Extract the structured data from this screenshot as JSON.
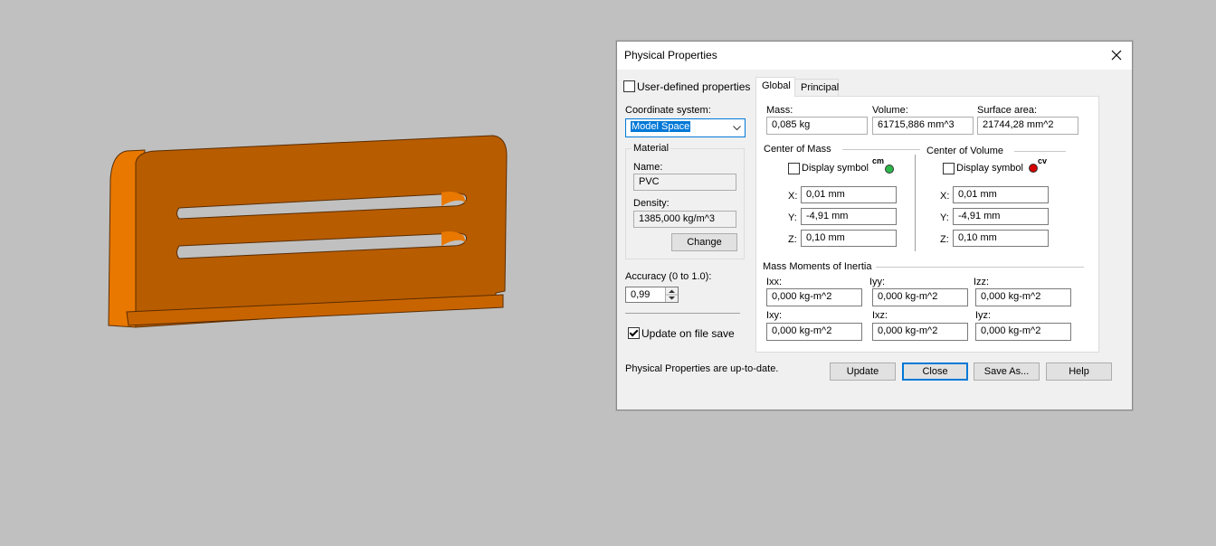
{
  "colors": {
    "part_main": "#b85c00",
    "part_side": "#e97800",
    "part_edge": "#5a2d00",
    "cm_dot": "#2db84a",
    "cv_dot": "#d40000",
    "accent": "#0078d7"
  },
  "dialog": {
    "title": "Physical Properties",
    "close_icon": "close-icon",
    "user_defined": {
      "label": "User-defined properties",
      "checked": false
    },
    "coord_label": "Coordinate system:",
    "coord_value": "Model Space",
    "material": {
      "group_label": "Material",
      "name_label": "Name:",
      "name_value": "PVC",
      "density_label": "Density:",
      "density_value": "1385,000 kg/m^3",
      "change_button": "Change"
    },
    "accuracy": {
      "label": "Accuracy (0 to 1.0):",
      "value": "0,99"
    },
    "update_on_save": {
      "label": "Update on file save",
      "checked": true
    },
    "status": "Physical Properties are up-to-date.",
    "tabs": [
      {
        "label": "Global",
        "active": true
      },
      {
        "label": "Principal",
        "active": false
      }
    ],
    "global": {
      "mass_label": "Mass:",
      "mass_value": "0,085 kg",
      "volume_label": "Volume:",
      "volume_value": "61715,886 mm^3",
      "surface_label": "Surface area:",
      "surface_value": "21744,28 mm^2",
      "com": {
        "title": "Center of Mass",
        "display_label": "Display symbol",
        "symbol": "cm",
        "x_label": "X:",
        "x": "0,01 mm",
        "y_label": "Y:",
        "y": "-4,91 mm",
        "z_label": "Z:",
        "z": "0,10 mm"
      },
      "cov": {
        "title": "Center of Volume",
        "display_label": "Display symbol",
        "symbol": "cv",
        "x_label": "X:",
        "x": "0,01 mm",
        "y_label": "Y:",
        "y": "-4,91 mm",
        "z_label": "Z:",
        "z": "0,10 mm"
      },
      "inertia": {
        "title": "Mass Moments of Inertia",
        "ixx_label": "Ixx:",
        "ixx": "0,000 kg-m^2",
        "iyy_label": "Iyy:",
        "iyy": "0,000 kg-m^2",
        "izz_label": "Izz:",
        "izz": "0,000 kg-m^2",
        "ixy_label": "Ixy:",
        "ixy": "0,000 kg-m^2",
        "ixz_label": "Ixz:",
        "ixz": "0,000 kg-m^2",
        "iyz_label": "Iyz:",
        "iyz": "0,000 kg-m^2"
      }
    },
    "buttons": {
      "update": "Update",
      "close": "Close",
      "save_as": "Save As...",
      "help": "Help"
    }
  }
}
